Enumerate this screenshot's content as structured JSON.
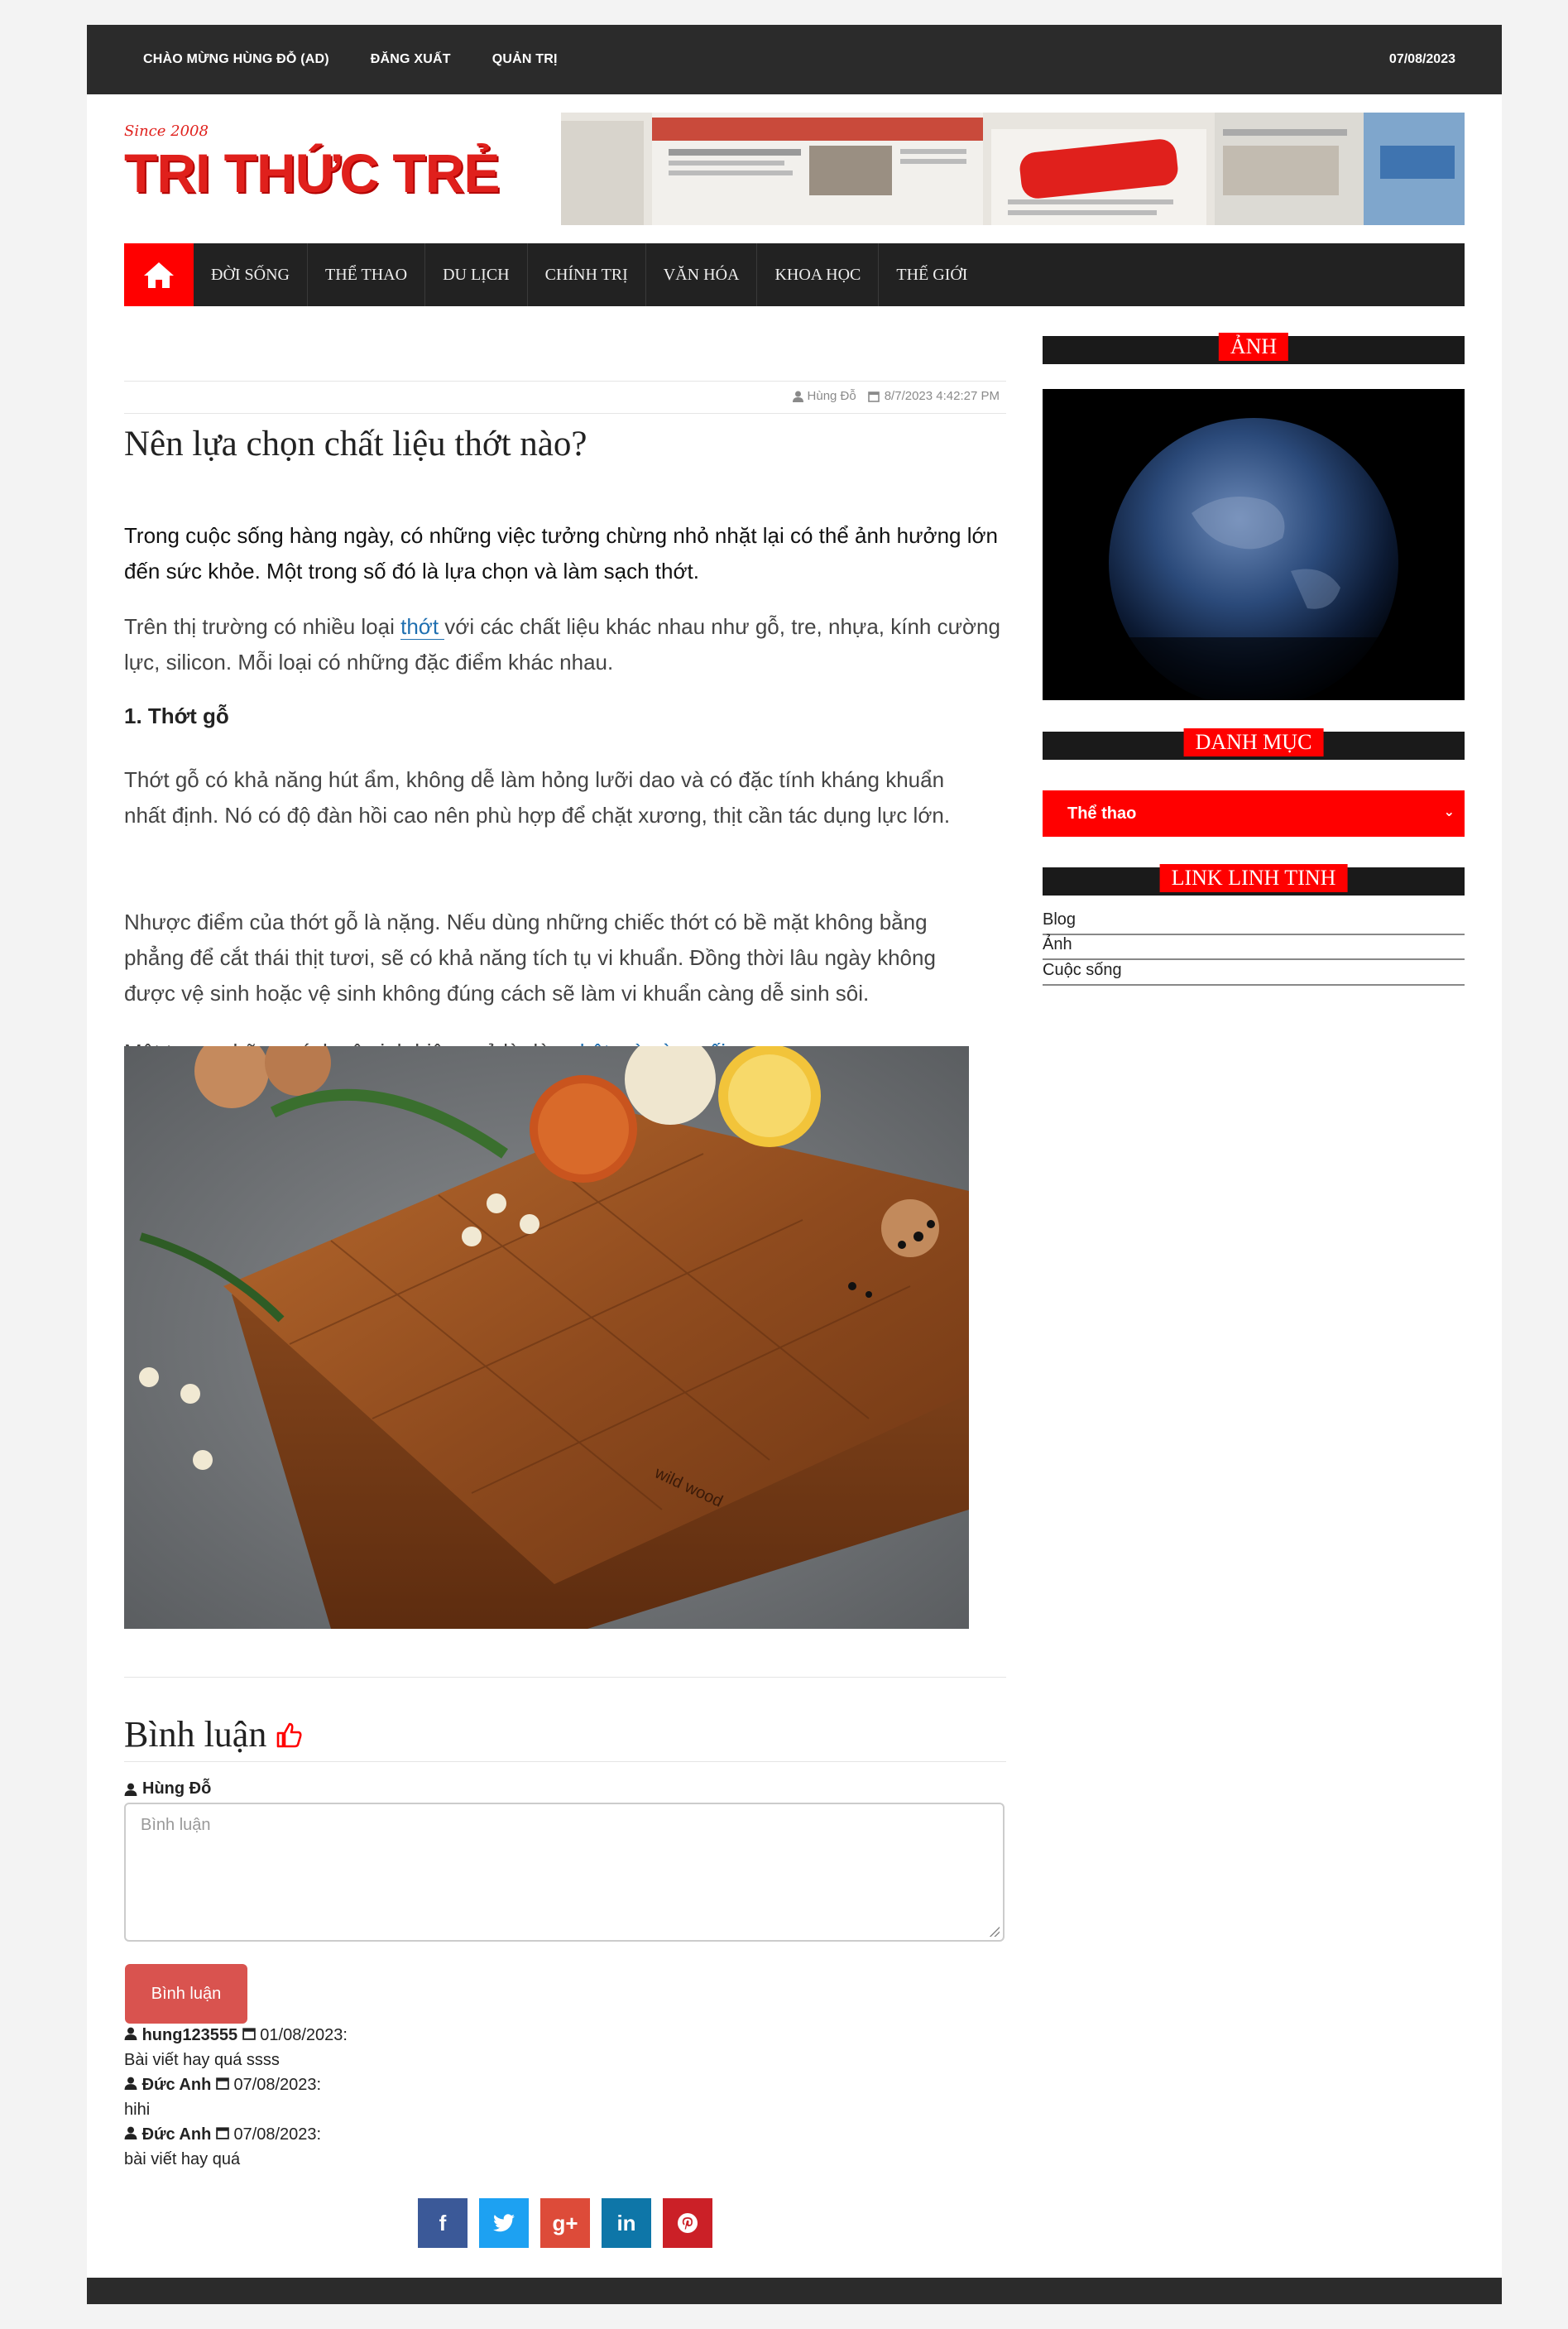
{
  "topbar": {
    "welcome": "CHÀO MỪNG HÙNG ĐỖ (AD)",
    "logout": "ĐĂNG XUẤT",
    "admin": "QUẢN TRỊ",
    "date": "07/08/2023"
  },
  "logo": {
    "since": "Since 2008",
    "name": "TRI THỨC TRẺ"
  },
  "nav": {
    "items": [
      "ĐỜI SỐNG",
      "THỂ THAO",
      "DU LỊCH",
      "CHÍNH TRỊ",
      "VĂN HÓA",
      "KHOA HỌC",
      "THẾ GIỚI"
    ]
  },
  "article": {
    "author": "Hùng Đỗ",
    "datetime": "8/7/2023 4:42:27 PM",
    "title": "Nên lựa chọn chất liệu thớt nào?",
    "lead": "Trong cuộc sống hàng ngày, có những việc tưởng chừng nhỏ nhặt lại có thể ảnh hưởng lớn đến sức khỏe. Một trong số đó là lựa chọn và làm sạch thớt.",
    "p1_before": "Trên thị trường có nhiều loại ",
    "p1_link": "thớt ",
    "p1_after": "với các chất liệu khác nhau như gỗ, tre, nhựa, kính cường lực, silicon. Mỗi loại có những đặc điểm khác nhau.",
    "heading1": "1. Thớt gỗ",
    "p2": "Thớt gỗ có khả năng hút ẩm, không dễ làm hỏng lưỡi dao và có đặc tính kháng khuẩn nhất định. Nó có độ đàn hồi cao nên phù hợp để chặt xương, thịt cần tác dụng lực lớn.",
    "p3": "Nhược điểm của thớt gỗ là nặng. Nếu dùng những chiếc thớt có bề mặt không bằng phẳng để cắt thái thịt tươi, sẽ có khả năng tích tụ vi khuẩn. Đồng thời lâu ngày không được vệ sinh hoặc vệ sinh không đúng cách sẽ làm vi khuẩn càng dễ sinh sôi.",
    "p4_before": "Một trong những cách vệ sinh hiệu quả là dùng ",
    "p4_link": "bột mỳ và muối.",
    "board_brand": "wild wood"
  },
  "comments": {
    "title": "Bình luận",
    "current_user": "Hùng Đỗ",
    "placeholder": "Bình luận",
    "submit": "Bình luận",
    "items": [
      {
        "user": "hung123555",
        "date": "01/08/2023:",
        "text": "Bài viết hay quá ssss"
      },
      {
        "user": "Đức Anh",
        "date": "07/08/2023:",
        "text": "hihi"
      },
      {
        "user": "Đức Anh",
        "date": "07/08/2023:",
        "text": "bài viết hay quá"
      }
    ]
  },
  "share": {
    "facebook": "f",
    "twitter": "t",
    "googleplus": "g+",
    "linkedin": "in",
    "pinterest": "p"
  },
  "sidebar": {
    "photo_title": "ẢNH",
    "category_title": "DANH MỤC",
    "category_selected": "Thể thao",
    "links_title": "LINK LINH TINH",
    "links": [
      "Blog",
      "Ảnh",
      "Cuộc sống"
    ]
  },
  "colors": {
    "accent": "#ff0000",
    "dark": "#2b2b2b",
    "link": "#1f6fb0",
    "button": "#d9534f"
  }
}
